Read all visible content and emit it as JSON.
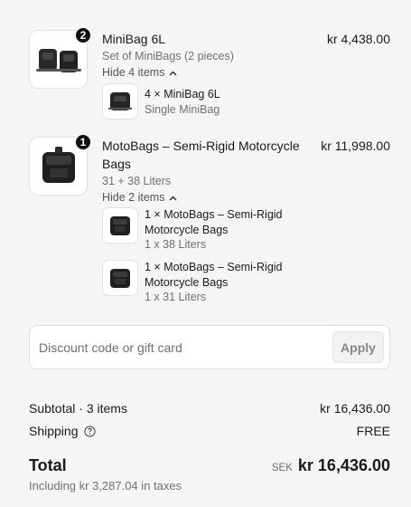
{
  "items": [
    {
      "title": "MiniBag 6L",
      "subtitle": "Set of MiniBags (2 pieces)",
      "toggle": "Hide 4 items",
      "quantity": "2",
      "price": "kr 4,438.00",
      "sub_items": [
        {
          "title": "4 × MiniBag 6L",
          "desc": "Single MiniBag"
        }
      ]
    },
    {
      "title": "MotoBags – Semi-Rigid Motorcycle Bags",
      "subtitle": "31 + 38 Liters",
      "toggle": "Hide 2 items",
      "quantity": "1",
      "price": "kr 11,998.00",
      "sub_items": [
        {
          "title": "1 × MotoBags – Semi-Rigid Motorcycle Bags",
          "desc": "1 x 38 Liters"
        },
        {
          "title": "1 × MotoBags – Semi-Rigid Motorcycle Bags",
          "desc": "1 x 31 Liters"
        }
      ]
    }
  ],
  "discount": {
    "placeholder": "Discount code or gift card",
    "value": "",
    "apply_label": "Apply"
  },
  "summary": {
    "subtotal_label": "Subtotal · 3 items",
    "subtotal_value": "kr 16,436.00",
    "shipping_label": "Shipping",
    "shipping_value": "FREE",
    "total_label": "Total",
    "currency": "SEK",
    "total_value": "kr 16,436.00",
    "taxes_note": "Including kr 3,287.04 in taxes"
  },
  "icons": {
    "product": "bag-icon",
    "toggle": "chevron-up-icon",
    "help": "question-circle-icon"
  }
}
